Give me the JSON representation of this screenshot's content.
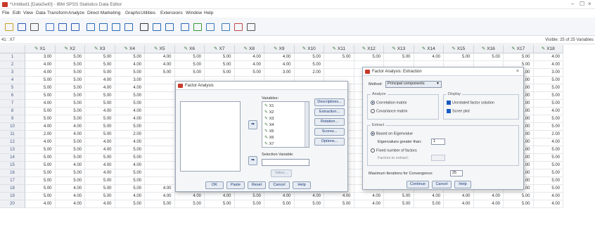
{
  "window": {
    "title": "*Untitled1 [DataSet0] - IBM SPSS Statistics Data Editor",
    "controls": [
      "–",
      "☐",
      "×"
    ]
  },
  "menu": [
    "File",
    "Edit",
    "View",
    "Data",
    "Transform",
    "Analyze",
    "Direct Marketing",
    "Graphs",
    "Utilities",
    "Extensions",
    "Window",
    "Help"
  ],
  "toolbar": {
    "icons": [
      "open-folder-icon",
      "save-icon",
      "print-icon",
      "dialog-recall-icon",
      "undo-icon",
      "redo-icon",
      "goto-case-icon",
      "goto-variable-icon",
      "variables-icon",
      "run-descriptives-icon",
      "find-icon",
      "insert-cases-icon",
      "insert-variable-icon",
      "split-file-icon",
      "weight-cases-icon",
      "select-cases-icon",
      "value-labels-icon",
      "use-sets-icon",
      "spelling-icon"
    ]
  },
  "cellbar": {
    "ref": "41 : X7",
    "visible": "Visible: 25 of 25 Variables"
  },
  "grid": {
    "columns": [
      "X1",
      "X2",
      "X3",
      "X4",
      "X5",
      "X6",
      "X7",
      "X8",
      "X9",
      "X10",
      "X11",
      "X12",
      "X13",
      "X14",
      "X15",
      "X16",
      "X17",
      "X18"
    ],
    "rows": [
      {
        "n": "1",
        "v": [
          "3.00",
          "5.00",
          "5.00",
          "5.00",
          "4.00",
          "5.00",
          "5.00",
          "4.00",
          "4.00",
          "5.00",
          "5.00",
          "5.00",
          "5.00",
          "4.00",
          "5.00",
          "5.00",
          "5.00",
          "4.00"
        ]
      },
      {
        "n": "2",
        "v": [
          "4.00",
          "5.00",
          "5.00",
          "4.00",
          "4.00",
          "5.00",
          "5.00",
          "4.00",
          "4.00",
          "5.00",
          "",
          "",
          "",
          "",
          "",
          "",
          "5.00",
          "4.00"
        ]
      },
      {
        "n": "3",
        "v": [
          "4.00",
          "5.00",
          "5.00",
          "5.00",
          "5.00",
          "5.00",
          "5.00",
          "5.00",
          "3.00",
          "2.00",
          "",
          "",
          "",
          "",
          "",
          "",
          "5.00",
          "3.00"
        ]
      },
      {
        "n": "4",
        "v": [
          "5.00",
          "5.00",
          "4.00",
          "3.00",
          "",
          "",
          "",
          "",
          "",
          "",
          "",
          "",
          "",
          "",
          "",
          "",
          "5.00",
          "5.00"
        ]
      },
      {
        "n": "5",
        "v": [
          "5.00",
          "5.00",
          "4.00",
          "4.00",
          "",
          "",
          "",
          "",
          "",
          "",
          "",
          "",
          "",
          "",
          "",
          "",
          "5.00",
          "5.00"
        ]
      },
      {
        "n": "6",
        "v": [
          "5.00",
          "5.00",
          "5.00",
          "5.00",
          "",
          "",
          "",
          "",
          "",
          "",
          "",
          "",
          "",
          "",
          "",
          "",
          "5.00",
          "5.00"
        ]
      },
      {
        "n": "7",
        "v": [
          "4.00",
          "5.00",
          "5.00",
          "5.00",
          "",
          "",
          "",
          "",
          "",
          "",
          "",
          "",
          "",
          "",
          "",
          "",
          "5.00",
          "5.00"
        ]
      },
      {
        "n": "8",
        "v": [
          "5.00",
          "5.00",
          "4.00",
          "4.00",
          "",
          "",
          "",
          "",
          "",
          "",
          "",
          "",
          "",
          "",
          "",
          "",
          "4.00",
          "4.00"
        ]
      },
      {
        "n": "9",
        "v": [
          "5.00",
          "5.00",
          "5.00",
          "4.00",
          "",
          "",
          "",
          "",
          "",
          "",
          "",
          "",
          "",
          "",
          "",
          "",
          "5.00",
          "5.00"
        ]
      },
      {
        "n": "10",
        "v": [
          "4.00",
          "4.00",
          "5.00",
          "5.00",
          "",
          "",
          "",
          "",
          "",
          "",
          "",
          "",
          "",
          "",
          "",
          "",
          "5.00",
          "5.00"
        ]
      },
      {
        "n": "11",
        "v": [
          "2.00",
          "4.00",
          "5.00",
          "2.00",
          "",
          "",
          "",
          "",
          "",
          "",
          "",
          "",
          "",
          "",
          "",
          "",
          "3.00",
          "2.00"
        ]
      },
      {
        "n": "12",
        "v": [
          "4.00",
          "5.00",
          "4.00",
          "4.00",
          "",
          "",
          "",
          "",
          "",
          "",
          "",
          "",
          "",
          "",
          "",
          "",
          "5.00",
          "4.00"
        ]
      },
      {
        "n": "13",
        "v": [
          "5.00",
          "5.00",
          "4.00",
          "5.00",
          "",
          "",
          "",
          "",
          "",
          "",
          "",
          "",
          "",
          "",
          "",
          "",
          "5.00",
          "5.00"
        ]
      },
      {
        "n": "14",
        "v": [
          "5.00",
          "5.00",
          "5.00",
          "5.00",
          "",
          "",
          "",
          "",
          "",
          "",
          "",
          "",
          "",
          "",
          "",
          "",
          "3.00",
          "5.00"
        ]
      },
      {
        "n": "15",
        "v": [
          "5.00",
          "4.00",
          "4.00",
          "4.00",
          "",
          "",
          "",
          "",
          "",
          "",
          "",
          "",
          "",
          "",
          "",
          "",
          "4.00",
          "5.00"
        ]
      },
      {
        "n": "16",
        "v": [
          "5.00",
          "5.00",
          "4.00",
          "5.00",
          "",
          "",
          "",
          "",
          "",
          "",
          "",
          "",
          "",
          "",
          "",
          "",
          "5.00",
          "5.00"
        ]
      },
      {
        "n": "17",
        "v": [
          "5.00",
          "5.00",
          "5.00",
          "5.00",
          "",
          "",
          "",
          "",
          "",
          "",
          "",
          "",
          "",
          "",
          "",
          "",
          "5.00",
          "5.00"
        ]
      },
      {
        "n": "18",
        "v": [
          "5.00",
          "4.00",
          "5.00",
          "5.00",
          "4.00",
          "4.00",
          "4.00",
          "5.00",
          "5.00",
          "5.00",
          "",
          "",
          "",
          "",
          "",
          "",
          "5.00",
          "5.00"
        ]
      },
      {
        "n": "19",
        "v": [
          "5.00",
          "4.00",
          "5.00",
          "4.00",
          "4.00",
          "4.00",
          "4.00",
          "5.00",
          "4.00",
          "4.00",
          "4.00",
          "4.00",
          "5.00",
          "4.00",
          "4.00",
          "4.00",
          "5.00",
          "4.00"
        ]
      },
      {
        "n": "20",
        "v": [
          "4.00",
          "4.00",
          "4.00",
          "5.00",
          "5.00",
          "5.00",
          "5.00",
          "5.00",
          "5.00",
          "5.00",
          "5.00",
          "4.00",
          "5.00",
          "5.00",
          "4.00",
          "4.00",
          "5.00",
          "4.00"
        ]
      }
    ]
  },
  "factor_dialog": {
    "title": "Factor Analysis",
    "variables_label": "Variables:",
    "variables": [
      "X1",
      "X2",
      "X3",
      "X4",
      "X5",
      "X6",
      "X7"
    ],
    "selection_label": "Selection Variable:",
    "value_btn": "Value...",
    "side_buttons": [
      "Descriptives...",
      "Extraction...",
      "Rotation...",
      "Scores...",
      "Options..."
    ],
    "bottom_buttons": [
      "OK",
      "Paste",
      "Reset",
      "Cancel",
      "Help"
    ]
  },
  "extraction_dialog": {
    "title": "Factor Analysis: Extraction",
    "method_label": "Method:",
    "method_value": "Principal components",
    "analyze_title": "Analyze",
    "analyze_opts": [
      "Correlation matrix",
      "Covariance matrix"
    ],
    "display_title": "Display",
    "display_opts": [
      "Unrotated factor solution",
      "Scree plot"
    ],
    "extract_title": "Extract",
    "eigen_opt": "Based on Eigenvalue",
    "eigen_label": "Eigenvalues greater than:",
    "eigen_value": "1",
    "fixed_opt": "Fixed number of factors",
    "factors_label": "Factors to extract:",
    "maxiter_label": "Maximum Iterations for Convergence:",
    "maxiter_value": "25",
    "buttons": [
      "Continue",
      "Cancel",
      "Help"
    ]
  },
  "colors": {
    "pen": "#3c7a3c",
    "accent": "#1a4a9a"
  }
}
